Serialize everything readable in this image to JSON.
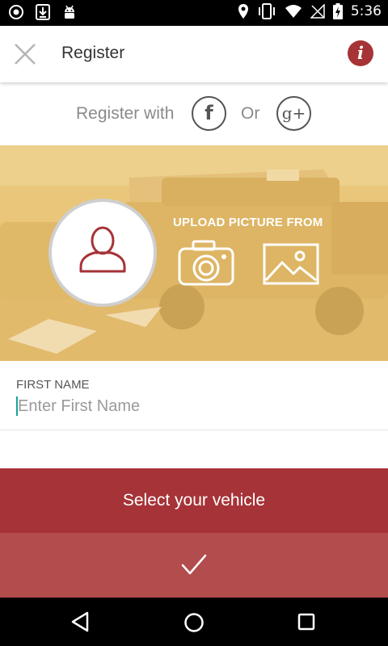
{
  "status_bar": {
    "time": "5:36",
    "left_icons": [
      "record-icon",
      "download-icon",
      "android-icon"
    ],
    "right_icons": [
      "location-icon",
      "vibrate-icon",
      "wifi-icon",
      "no-signal-icon",
      "battery-charging-icon"
    ]
  },
  "app_bar": {
    "title": "Register",
    "close_icon": "close-icon",
    "info_icon": "info-icon",
    "info_glyph": "i"
  },
  "social": {
    "register_with": "Register with",
    "facebook_glyph": "f",
    "or": "Or",
    "google_glyph": "g+"
  },
  "photo": {
    "upload_label": "UPLOAD PICTURE FROM",
    "avatar_icon": "user-icon",
    "camera_icon": "camera-icon",
    "gallery_icon": "image-icon"
  },
  "form": {
    "first_name_label": "FIRST NAME",
    "first_name_placeholder": "Enter First Name",
    "first_name_value": ""
  },
  "actions": {
    "select_vehicle": "Select your vehicle",
    "confirm_icon": "check-icon"
  },
  "nav_bar": {
    "icons": [
      "back-icon",
      "home-icon",
      "recents-icon"
    ]
  },
  "colors": {
    "accent_red": "#a63337",
    "confirm_red": "#b24c4d",
    "photo_panel": "#e9c67a",
    "cursor": "#1aa39a"
  }
}
